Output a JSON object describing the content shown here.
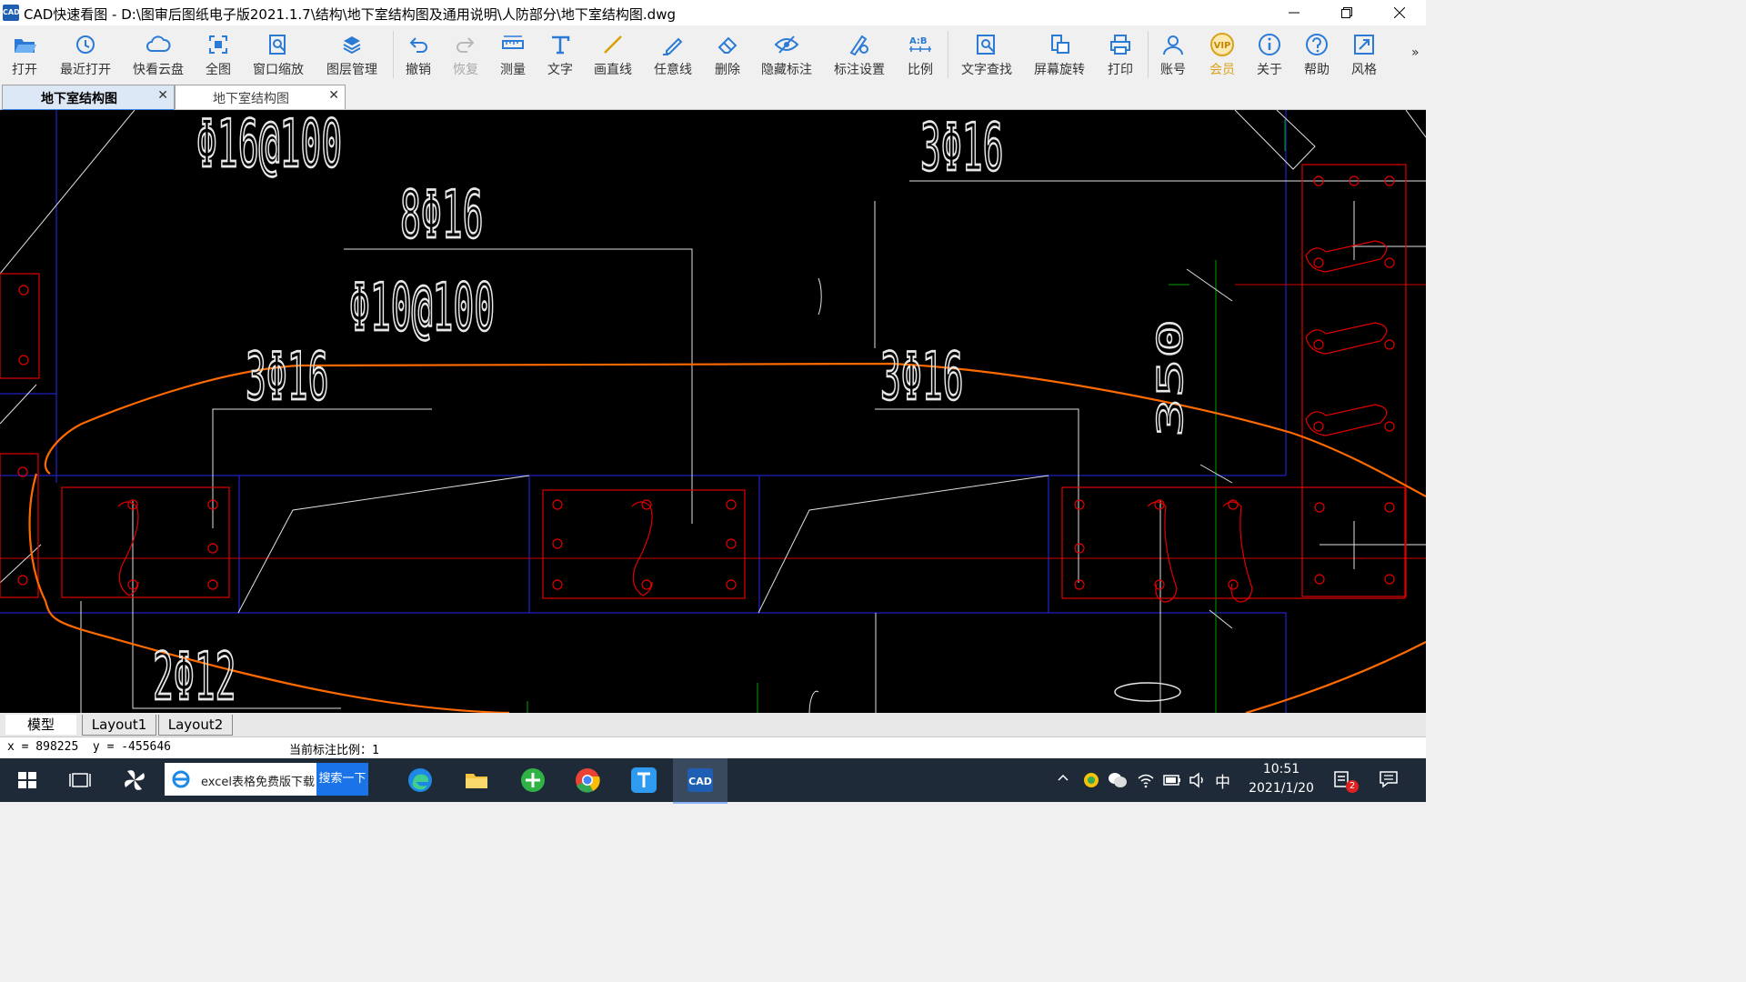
{
  "window": {
    "app_icon_text": "CAD",
    "title": "CAD快速看图 - D:\\图审后图纸电子版2021.1.7\\结构\\地下室结构图及通用说明\\人防部分\\地下室结构图.dwg"
  },
  "toolbar": {
    "items": [
      {
        "label": "打开",
        "icon": "folder-open-icon"
      },
      {
        "label": "最近打开",
        "icon": "clock-history-icon"
      },
      {
        "label": "快看云盘",
        "icon": "cloud-icon"
      },
      {
        "label": "全图",
        "icon": "fullview-icon"
      },
      {
        "label": "窗口缩放",
        "icon": "zoom-window-icon"
      },
      {
        "label": "图层管理",
        "icon": "layers-icon"
      },
      {
        "label": "撤销",
        "icon": "undo-icon"
      },
      {
        "label": "恢复",
        "icon": "redo-icon"
      },
      {
        "label": "测量",
        "icon": "ruler-icon"
      },
      {
        "label": "文字",
        "icon": "text-t-icon"
      },
      {
        "label": "画直线",
        "icon": "line-icon"
      },
      {
        "label": "任意线",
        "icon": "pen-icon"
      },
      {
        "label": "删除",
        "icon": "eraser-icon"
      },
      {
        "label": "隐藏标注",
        "icon": "eye-hide-icon"
      },
      {
        "label": "标注设置",
        "icon": "annotation-settings-icon"
      },
      {
        "label": "比例",
        "icon": "scale-ab-icon"
      },
      {
        "label": "文字查找",
        "icon": "text-search-icon"
      },
      {
        "label": "屏幕旋转",
        "icon": "rotate-screen-icon"
      },
      {
        "label": "打印",
        "icon": "printer-icon"
      },
      {
        "label": "账号",
        "icon": "user-icon"
      },
      {
        "label": "会员",
        "icon": "vip-icon",
        "badge": "VIP"
      },
      {
        "label": "关于",
        "icon": "info-icon"
      },
      {
        "label": "帮助",
        "icon": "help-icon"
      },
      {
        "label": "风格",
        "icon": "style-icon"
      }
    ],
    "more": "»"
  },
  "doc_tabs": [
    {
      "label": "地下室结构图",
      "active": true
    },
    {
      "label": "地下室结构图",
      "active": false
    }
  ],
  "drawing": {
    "texts": [
      "Φ16@100",
      "8Φ16",
      "Φ10@100",
      "3Φ16",
      "3Φ16",
      "3Φ16",
      "2Φ12",
      "350"
    ]
  },
  "layout_tabs": [
    "模型",
    "Layout1",
    "Layout2"
  ],
  "status": {
    "coords": "x = 898225  y = -455646",
    "scale": "当前标注比例：1"
  },
  "taskbar": {
    "search_text": "excel表格免费版下载",
    "search_button": "搜索一下",
    "ime": "中",
    "time": "10:51",
    "date": "2021/1/20",
    "notification_count": "2"
  },
  "colors": {
    "cad_background": "#000000",
    "cloud_line": "#ff6a00",
    "rebar_red": "#e00000",
    "outline_blue": "#2020c0",
    "axis_green": "#00a000"
  }
}
